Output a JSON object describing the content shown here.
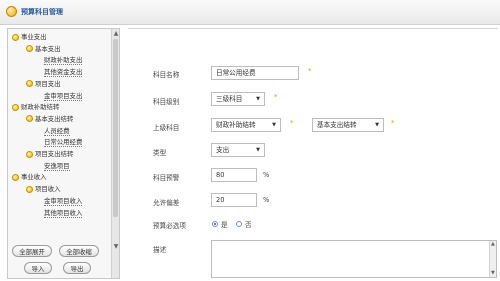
{
  "header": {
    "title": "预算科目管理"
  },
  "tree": {
    "items": [
      {
        "label": "事业支出",
        "level": 0,
        "icon": "folder-dot"
      },
      {
        "label": "基本支出",
        "level": 1,
        "icon": "folder-dot"
      },
      {
        "label": "财政补助支出",
        "level": 2
      },
      {
        "label": "其他资金支出",
        "level": 2
      },
      {
        "label": "项目支出",
        "level": 1,
        "icon": "folder-dot"
      },
      {
        "label": "金审项目支出",
        "level": 2
      },
      {
        "label": "财政补助结转",
        "level": 0,
        "icon": "folder-dot"
      },
      {
        "label": "基本支出结转",
        "level": 1,
        "icon": "folder-dot"
      },
      {
        "label": "人员经费",
        "level": 2
      },
      {
        "label": "日常公用经费",
        "level": 2
      },
      {
        "label": "项目支出结转",
        "level": 1,
        "icon": "folder-dot"
      },
      {
        "label": "安逸项目",
        "level": 2
      },
      {
        "label": "事业收入",
        "level": 0,
        "icon": "folder-dot"
      },
      {
        "label": "项目收入",
        "level": 1,
        "icon": "folder-dot"
      },
      {
        "label": "金审项目收入",
        "level": 2
      },
      {
        "label": "其他项目收入",
        "level": 2
      }
    ],
    "buttons": {
      "expand_all": "全部展开",
      "collapse_all": "全部收缩",
      "import": "导入",
      "export": "导出"
    }
  },
  "form": {
    "name_label": "科目名称",
    "name_value": "日常公用经费",
    "level_label": "科目级别",
    "level_value": "三级科目",
    "parent_label": "上级科目",
    "parent_value_1": "财政补助结转",
    "parent_value_2": "基本支出结转",
    "type_label": "类型",
    "type_value": "支出",
    "warn_label": "科目预警",
    "warn_value": "80",
    "allow_label": "允许偏差",
    "allow_value": "20",
    "percent": "%",
    "required_mark": "*",
    "must_fill_label": "预算必选项",
    "yes": "是",
    "no": "否",
    "desc_label": "描述"
  },
  "colors": {
    "title": "#2b5a9b",
    "required": "#e0a000",
    "radio": "#2758c9"
  }
}
